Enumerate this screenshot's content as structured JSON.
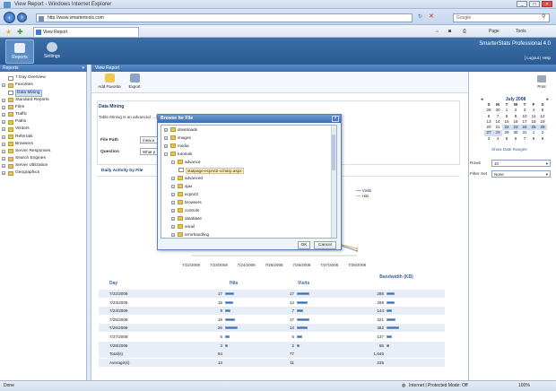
{
  "window": {
    "title": "View Report - Windows Internet Explorer"
  },
  "addressbar": {
    "url": "http://www.smartertools.com",
    "search_placeholder": "Google"
  },
  "commandbar": {
    "tab_label": "View Report",
    "page_label": "Page",
    "tools_label": "Tools"
  },
  "app": {
    "product_name": "SmarterStats Professional 4.0",
    "top_links": "[ Logout | Help",
    "nav": [
      {
        "label": "Reports"
      },
      {
        "label": "Settings"
      }
    ]
  },
  "sidebar": {
    "header": "Reports",
    "items": [
      {
        "label": "7 Day Overview"
      },
      {
        "label": "Favorites"
      },
      {
        "label": "Data Mining"
      },
      {
        "label": "Standard Reports"
      },
      {
        "label": "Files"
      },
      {
        "label": "Traffic"
      },
      {
        "label": "Paths"
      },
      {
        "label": "Visitors"
      },
      {
        "label": "Referrals"
      },
      {
        "label": "Browsers"
      },
      {
        "label": "Server Responses"
      },
      {
        "label": "Search Engines"
      },
      {
        "label": "Server Utilization"
      },
      {
        "label": "Geographics"
      }
    ]
  },
  "main": {
    "header": "View Report",
    "toolbar": {
      "add_favorite": "Add Favorite",
      "export": "Export",
      "print": "Print"
    },
    "section_title": "Data Mining",
    "description": "Table Mining is an advanced ... [occluded] ... by using the calendar on the right. Please note, the results may take a few ...",
    "file_path_label": "File Path",
    "file_path_value": "/new.a",
    "question_label": "Question",
    "question_value": "What p",
    "daily_activity_label": "Daily Activity by File",
    "legend": [
      {
        "label": "Visits",
        "color": "#5b8fd0"
      },
      {
        "label": "Hits",
        "color": "#f0a030"
      }
    ]
  },
  "chart_data": {
    "type": "line",
    "x": [
      "7/22/2008",
      "7/23/2008",
      "7/24/2008",
      "7/25/2008",
      "7/26/2008",
      "7/27/2008",
      "7/28/2008"
    ],
    "series": [
      {
        "name": "Visits",
        "values": [
          17,
          14,
          7,
          17,
          14,
          6,
          2
        ]
      },
      {
        "name": "Hits",
        "values": [
          17,
          15,
          9,
          19,
          26,
          6,
          3
        ]
      }
    ]
  },
  "stats": {
    "headers": {
      "day": "Day",
      "hits": "Hits",
      "visits": "Visits",
      "bandwidth": "Bandwidth (KB)"
    },
    "rows": [
      {
        "day": "7/22/2008",
        "hits": "17",
        "visits": "17",
        "bw": "288",
        "hf": 0.65,
        "vf": 1.0,
        "bf": 0.62
      },
      {
        "day": "7/23/2008",
        "hits": "15",
        "visits": "14",
        "bw": "269",
        "hf": 0.58,
        "vf": 0.82,
        "bf": 0.58
      },
      {
        "day": "7/24/2008",
        "hits": "9",
        "visits": "7",
        "bw": "144",
        "hf": 0.35,
        "vf": 0.41,
        "bf": 0.31
      },
      {
        "day": "7/25/2008",
        "hits": "19",
        "visits": "17",
        "bw": "321",
        "hf": 0.73,
        "vf": 1.0,
        "bf": 0.69
      },
      {
        "day": "7/26/2008",
        "hits": "26",
        "visits": "14",
        "bw": "462",
        "hf": 1.0,
        "vf": 0.82,
        "bf": 1.0
      },
      {
        "day": "7/27/2008",
        "hits": "6",
        "visits": "6",
        "bw": "137",
        "hf": 0.23,
        "vf": 0.35,
        "bf": 0.3
      },
      {
        "day": "7/28/2008",
        "hits": "3",
        "visits": "2",
        "bw": "55",
        "hf": 0.12,
        "vf": 0.12,
        "bf": 0.12
      }
    ],
    "totals": {
      "label": "Total(s)",
      "hits": "94",
      "visits": "77",
      "bw": "1,646"
    },
    "averages": {
      "label": "Average(s)",
      "hits": "13",
      "visits": "11",
      "bw": "235"
    }
  },
  "calendar": {
    "month": "July 2008",
    "dow": [
      "S",
      "M",
      "T",
      "W",
      "T",
      "F",
      "S"
    ],
    "weeks": [
      [
        "29",
        "30",
        "1",
        "2",
        "3",
        "4",
        "5"
      ],
      [
        "6",
        "7",
        "8",
        "9",
        "10",
        "11",
        "12"
      ],
      [
        "13",
        "14",
        "15",
        "16",
        "17",
        "18",
        "19"
      ],
      [
        "20",
        "21",
        "22",
        "23",
        "24",
        "25",
        "26"
      ],
      [
        "27",
        "28",
        "29",
        "30",
        "31",
        "1",
        "2"
      ],
      [
        "3",
        "4",
        "5",
        "6",
        "7",
        "8",
        "9"
      ]
    ],
    "show_ranges": "Show Date Ranges"
  },
  "rightpanel": {
    "rows_label": "Rows",
    "rows_value": "10",
    "filter_label": "Filter Set",
    "filter_value": "None"
  },
  "dialog": {
    "title": "Browse for File",
    "items": [
      "downloads",
      "images",
      "media",
      "tutorials",
      "advance",
      "statpage-ecprvt2-ccharp.aspx",
      "advanced",
      "ajax",
      "ecprvt2",
      "browsers",
      "controls",
      "database",
      "email",
      "errorhandling"
    ],
    "ok": "OK",
    "cancel": "Cancel"
  },
  "statusbar": {
    "zone": "Internet | Protected Mode: Off",
    "zoom": "100%"
  }
}
